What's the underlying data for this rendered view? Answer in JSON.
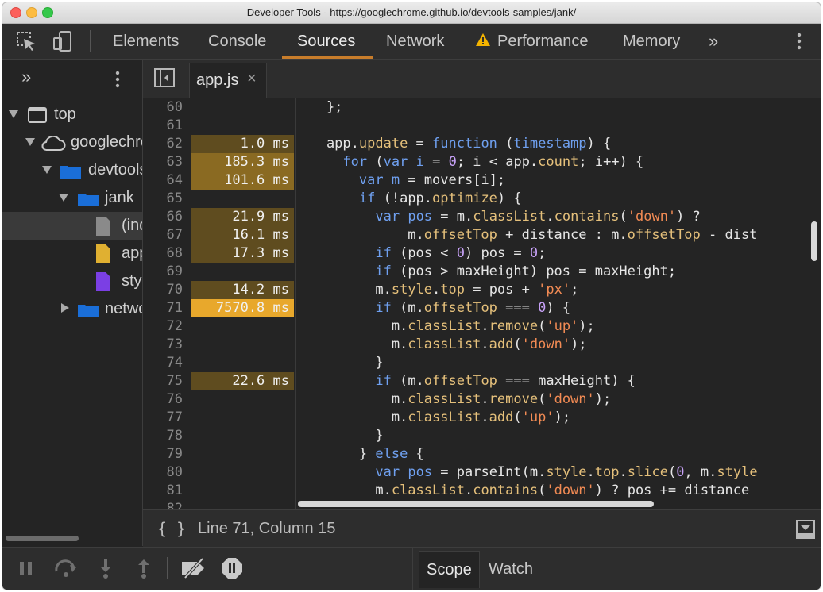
{
  "window": {
    "title": "Developer Tools - https://googlechrome.github.io/devtools-samples/jank/"
  },
  "toolbar": {
    "tabs": [
      "Elements",
      "Console",
      "Sources",
      "Network",
      "Performance",
      "Memory"
    ],
    "active_tab": "Sources",
    "more_label": "»"
  },
  "navigator": {
    "more_label": "»",
    "tree": [
      {
        "label": "top",
        "depth": 0,
        "icon": "window-icon",
        "expanded": true
      },
      {
        "label": "googlechrome.github.io",
        "depth": 1,
        "icon": "cloud-icon",
        "expanded": true
      },
      {
        "label": "devtools-samples",
        "depth": 2,
        "icon": "folder-icon",
        "expanded": true
      },
      {
        "label": "jank",
        "depth": 3,
        "icon": "folder-icon",
        "expanded": true
      },
      {
        "label": "(index)",
        "depth": 4,
        "icon": "document-icon",
        "selected": true
      },
      {
        "label": "app.js",
        "depth": 4,
        "icon": "js-file-icon"
      },
      {
        "label": "styles.css",
        "depth": 4,
        "icon": "css-file-icon"
      },
      {
        "label": "network",
        "depth": 3,
        "icon": "folder-icon",
        "expanded": false
      }
    ]
  },
  "editor": {
    "file_tab": {
      "name": "app.js",
      "close": "×"
    },
    "lines": [
      {
        "n": "60",
        "t": "",
        "code": "    };"
      },
      {
        "n": "61",
        "t": "",
        "code": ""
      },
      {
        "n": "62",
        "t": "1.0 ms",
        "code": "    app.update = function (timestamp) {"
      },
      {
        "n": "63",
        "t": "185.3 ms",
        "code": "      for (var i = 0; i < app.count; i++) {"
      },
      {
        "n": "64",
        "t": "101.6 ms",
        "code": "        var m = movers[i];"
      },
      {
        "n": "65",
        "t": "",
        "code": "        if (!app.optimize) {"
      },
      {
        "n": "66",
        "t": "21.9 ms",
        "code": "          var pos = m.classList.contains('down') ?"
      },
      {
        "n": "67",
        "t": "16.1 ms",
        "code": "              m.offsetTop + distance : m.offsetTop - dist"
      },
      {
        "n": "68",
        "t": "17.3 ms",
        "code": "          if (pos < 0) pos = 0;"
      },
      {
        "n": "69",
        "t": "",
        "code": "          if (pos > maxHeight) pos = maxHeight;"
      },
      {
        "n": "70",
        "t": "14.2 ms",
        "code": "          m.style.top = pos + 'px';"
      },
      {
        "n": "71",
        "t": "7570.8 ms",
        "code": "          if (m.offsetTop === 0) {"
      },
      {
        "n": "72",
        "t": "",
        "code": "            m.classList.remove('up');"
      },
      {
        "n": "73",
        "t": "",
        "code": "            m.classList.add('down');"
      },
      {
        "n": "74",
        "t": "",
        "code": "          }"
      },
      {
        "n": "75",
        "t": "22.6 ms",
        "code": "          if (m.offsetTop === maxHeight) {"
      },
      {
        "n": "76",
        "t": "",
        "code": "            m.classList.remove('down');"
      },
      {
        "n": "77",
        "t": "",
        "code": "            m.classList.add('up');"
      },
      {
        "n": "78",
        "t": "",
        "code": "          }"
      },
      {
        "n": "79",
        "t": "",
        "code": "        } else {"
      },
      {
        "n": "80",
        "t": "",
        "code": "          var pos = parseInt(m.style.top.slice(0, m.style"
      },
      {
        "n": "81",
        "t": "",
        "code": "          m.classList.contains('down') ? pos += distance"
      },
      {
        "n": "82",
        "t": "",
        "code": ""
      }
    ]
  },
  "statusbar": {
    "braces": "{ }",
    "position": "Line 71, Column 15"
  },
  "debugger": {
    "tabs": [
      "Scope",
      "Watch"
    ],
    "active_tab": "Scope"
  },
  "colors": {
    "timing_low": "#5f4c1f",
    "timing_mid": "#8a6a22",
    "timing_high": "#e8a82c",
    "active_tab_underline": "#c87d2b"
  }
}
